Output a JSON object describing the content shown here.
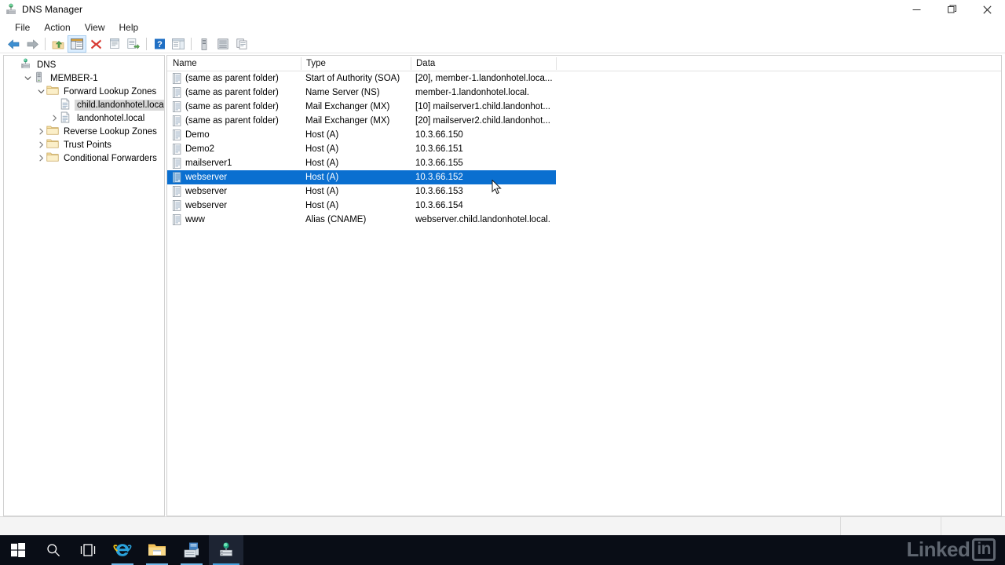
{
  "window": {
    "title": "DNS Manager",
    "title_icon": "dns-server-icon",
    "controls": {
      "minimize": "─",
      "maximize": "❐",
      "close": "✕"
    }
  },
  "menubar": {
    "items": [
      "File",
      "Action",
      "View",
      "Help"
    ]
  },
  "toolbar": {
    "buttons": [
      {
        "name": "back-button",
        "icon": "arrow-left-icon"
      },
      {
        "name": "forward-button",
        "icon": "arrow-right-icon"
      },
      {
        "name": "up-one-level-button",
        "icon": "folder-up-icon"
      },
      {
        "name": "show-hide-console-tree-button",
        "icon": "console-tree-icon"
      },
      {
        "name": "delete-button",
        "icon": "red-x-icon"
      },
      {
        "name": "properties-button",
        "icon": "properties-icon"
      },
      {
        "name": "export-list-button",
        "icon": "export-list-icon"
      },
      {
        "name": "help-button",
        "icon": "question-mark-icon"
      },
      {
        "name": "show-hide-action-pane-button",
        "icon": "action-pane-icon"
      },
      {
        "name": "new-server-button",
        "icon": "server-icon"
      },
      {
        "name": "new-zone-button",
        "icon": "zone-list-icon"
      },
      {
        "name": "copy-button",
        "icon": "copy-icon"
      }
    ]
  },
  "tree": {
    "nodes": [
      {
        "label": "DNS",
        "indent": 0,
        "twist": "none",
        "icon": "dns-root-icon",
        "selected": false
      },
      {
        "label": "MEMBER-1",
        "indent": 1,
        "twist": "expanded",
        "icon": "server-icon",
        "selected": false
      },
      {
        "label": "Forward Lookup Zones",
        "indent": 2,
        "twist": "expanded",
        "icon": "folder-icon",
        "selected": false
      },
      {
        "label": "child.landonhotel.local",
        "indent": 3,
        "twist": "none",
        "icon": "zone-icon",
        "selected": true
      },
      {
        "label": "landonhotel.local",
        "indent": 3,
        "twist": "collapsed",
        "icon": "zone-icon",
        "selected": false
      },
      {
        "label": "Reverse Lookup Zones",
        "indent": 2,
        "twist": "collapsed",
        "icon": "folder-icon",
        "selected": false
      },
      {
        "label": "Trust Points",
        "indent": 2,
        "twist": "collapsed",
        "icon": "folder-icon",
        "selected": false
      },
      {
        "label": "Conditional Forwarders",
        "indent": 2,
        "twist": "collapsed",
        "icon": "folder-icon",
        "selected": false
      }
    ]
  },
  "list": {
    "columns": [
      "Name",
      "Type",
      "Data"
    ],
    "rows": [
      {
        "name": "(same as parent folder)",
        "type": "Start of Authority (SOA)",
        "data": "[20], member-1.landonhotel.loca...",
        "selected": false
      },
      {
        "name": "(same as parent folder)",
        "type": "Name Server (NS)",
        "data": "member-1.landonhotel.local.",
        "selected": false
      },
      {
        "name": "(same as parent folder)",
        "type": "Mail Exchanger (MX)",
        "data": "[10]  mailserver1.child.landonhot...",
        "selected": false
      },
      {
        "name": "(same as parent folder)",
        "type": "Mail Exchanger (MX)",
        "data": "[20]  mailserver2.child.landonhot...",
        "selected": false
      },
      {
        "name": "Demo",
        "type": "Host (A)",
        "data": "10.3.66.150",
        "selected": false
      },
      {
        "name": "Demo2",
        "type": "Host (A)",
        "data": "10.3.66.151",
        "selected": false
      },
      {
        "name": "mailserver1",
        "type": "Host (A)",
        "data": "10.3.66.155",
        "selected": false
      },
      {
        "name": "webserver",
        "type": "Host (A)",
        "data": "10.3.66.152",
        "selected": true
      },
      {
        "name": "webserver",
        "type": "Host (A)",
        "data": "10.3.66.153",
        "selected": false
      },
      {
        "name": "webserver",
        "type": "Host (A)",
        "data": "10.3.66.154",
        "selected": false
      },
      {
        "name": "www",
        "type": "Alias (CNAME)",
        "data": "webserver.child.landonhotel.local.",
        "selected": false
      }
    ]
  },
  "taskbar": {
    "items": [
      {
        "name": "start-button",
        "icon": "windows-logo-icon"
      },
      {
        "name": "search-button",
        "icon": "search-icon"
      },
      {
        "name": "task-view-button",
        "icon": "task-view-icon"
      },
      {
        "name": "internet-explorer-button",
        "icon": "internet-explorer-icon"
      },
      {
        "name": "file-explorer-button",
        "icon": "folder-icon"
      },
      {
        "name": "server-manager-button",
        "icon": "server-manager-icon"
      },
      {
        "name": "dns-manager-button",
        "icon": "dns-server-icon"
      }
    ]
  },
  "watermark": {
    "text": "Linked",
    "badge": "in"
  },
  "colors": {
    "selection_blue": "#0a6fd0",
    "tree_selection_gray": "#d8d8d8",
    "taskbar": "#090d16",
    "accent_underline": "#48a3e0"
  }
}
